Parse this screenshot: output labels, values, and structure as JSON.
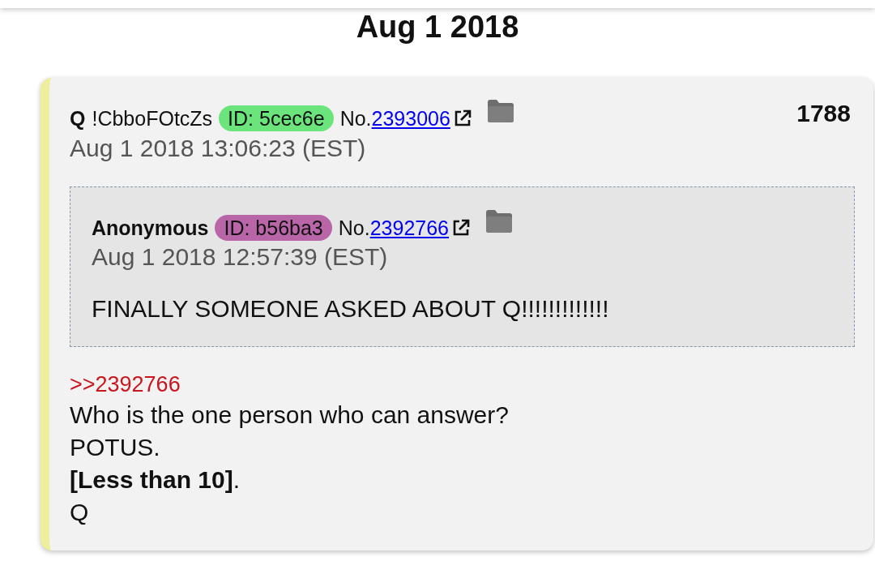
{
  "date_heading": "Aug 1 2018",
  "post": {
    "name": "Q",
    "tripcode": "!CbboFOtcZs",
    "id_badge": {
      "text": "ID: 5cec6e",
      "color": "#6be47c"
    },
    "number_prefix": "No.",
    "number_link": "2393006",
    "count": "1788",
    "timestamp": "Aug 1 2018 13:06:23 (EST)",
    "quoted_post": {
      "name": "Anonymous",
      "id_badge": {
        "text": "ID: b56ba3",
        "color": "#b866a8"
      },
      "number_prefix": "No.",
      "number_link": "2392766",
      "timestamp": "Aug 1 2018 12:57:39 (EST)",
      "body": [
        {
          "kind": "line",
          "text": "FINALLY SOMEONE ASKED ABOUT Q!!!!!!!!!!!!!"
        }
      ]
    },
    "body": [
      {
        "kind": "reply_link",
        "text": ">>2392766"
      },
      {
        "kind": "line",
        "text": "Who is the one person who can answer?"
      },
      {
        "kind": "line",
        "text": "POTUS."
      },
      {
        "kind": "line",
        "text": "**[Less than 10]**."
      },
      {
        "kind": "line",
        "text": "Q"
      }
    ]
  }
}
